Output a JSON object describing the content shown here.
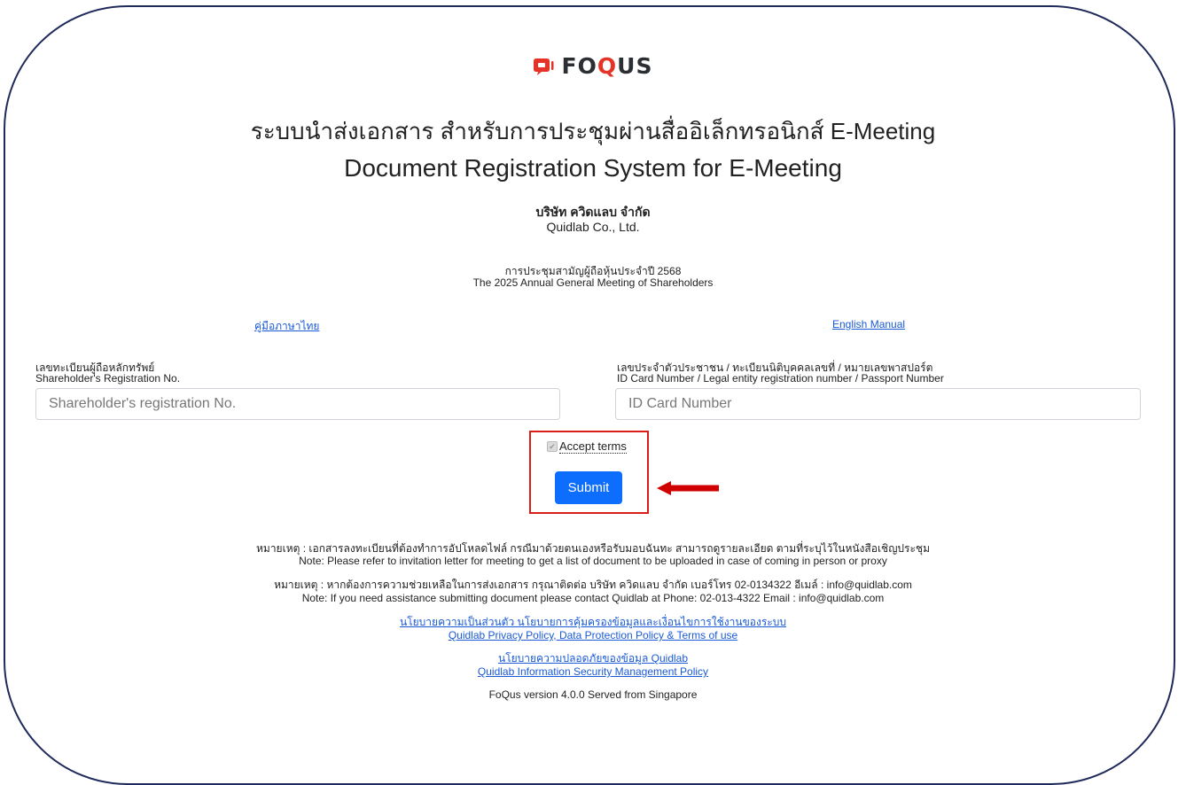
{
  "logo": {
    "text_prefix": "FO",
    "text_q": "Q",
    "text_suffix": "US"
  },
  "header": {
    "title_th": "ระบบนำส่งเอกสาร สำหรับการประชุมผ่านสื่ออิเล็กทรอนิกส์ E-Meeting",
    "title_en": "Document Registration System for E-Meeting",
    "company_th": "บริษัท ควิดแลบ จำกัด",
    "company_en": "Quidlab Co., Ltd.",
    "meeting_th": "การประชุมสามัญผู้ถือหุ้นประจำปี 2568",
    "meeting_en": "The 2025 Annual General Meeting of Shareholders"
  },
  "manuals": {
    "thai": "คู่มือภาษาไทย",
    "english": "English Manual"
  },
  "form": {
    "shareholder_label_th": "เลขทะเบียนผู้ถือหลักทรัพย์",
    "shareholder_label_en": "Shareholder's Registration No.",
    "shareholder_placeholder": "Shareholder's registration No.",
    "idcard_label_th": "เลขประจำตัวประชาชน / ทะเบียนนิติบุคคลเลขที่ / หมายเลขพาสปอร์ต",
    "idcard_label_en": "ID Card Number / Legal entity registration number / Passport Number",
    "idcard_placeholder": "ID Card Number",
    "accept_label": "Accept terms",
    "accept_checked": true,
    "submit_label": "Submit"
  },
  "annotation": {
    "box_color": "#d91e18",
    "arrow_color": "#d10000"
  },
  "notes": {
    "note1_th": "หมายเหตุ : เอกสารลงทะเบียนที่ต้องทำการอัปโหลดไฟล์ กรณีมาด้วยตนเองหรือรับมอบฉันทะ สามารถดูรายละเอียด ตามที่ระบุไว้ในหนังสือเชิญประชุม",
    "note1_en": "Note: Please refer to invitation letter for meeting to get a list of document to be uploaded in case of coming in person or proxy",
    "note2_th": "หมายเหตุ : หากต้องการความช่วยเหลือในการส่งเอกสาร กรุณาติดต่อ บริษัท ควิดแลบ จำกัด เบอร์โทร 02-0134322 อีเมล์ : info@quidlab.com",
    "note2_en": "Note: If you need assistance submitting document please contact Quidlab at Phone: 02-013-4322 Email : info@quidlab.com"
  },
  "policies": {
    "privacy_th": "นโยบายความเป็นส่วนตัว นโยบายการคุ้มครองข้อมูลและเงื่อนไขการใช้งานของระบบ",
    "privacy_en": "Quidlab Privacy Policy, Data Protection Policy & Terms of use",
    "security_th": "นโยบายความปลอดภัยของข้อมูล Quidlab",
    "security_en": "Quidlab Information Security Management Policy"
  },
  "footer": {
    "version": "FoQus version 4.0.0 Served from Singapore"
  }
}
